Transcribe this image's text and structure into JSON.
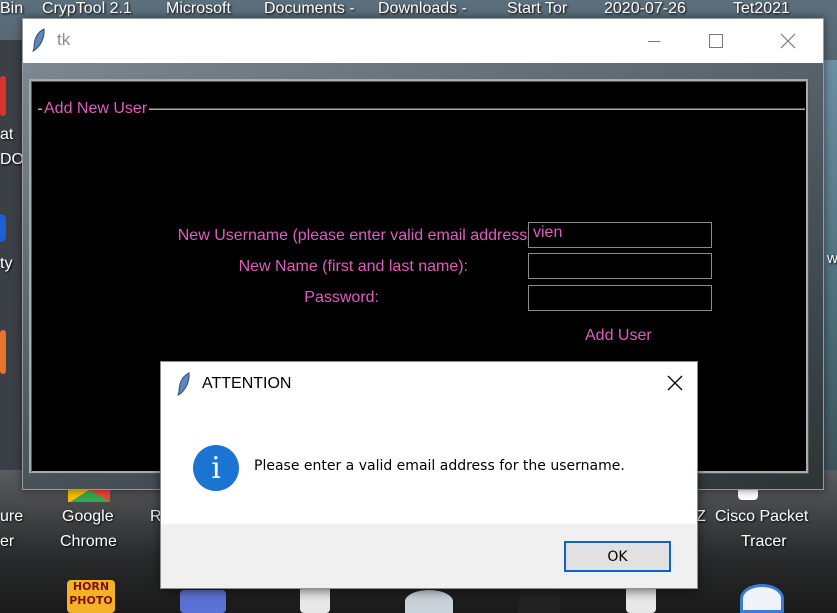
{
  "desktop": {
    "top_labels": [
      "Bin",
      "CrypTool 2.1",
      "Microsoft",
      "Documents -",
      "Downloads -",
      "Start Tor",
      "2020-07-26",
      "Tet2021"
    ],
    "left_labels": [
      "at",
      "DO",
      "ty",
      "ure",
      "er"
    ],
    "bottom_labels": [
      "Google",
      "Chrome",
      "Cisco Packet",
      "Tracer",
      "R",
      "Z",
      "w"
    ],
    "horn_icon_text": "HORN PHOTO"
  },
  "tk_window": {
    "title": "tk",
    "labelframe": "Add New User",
    "username_label": "New Username (please enter valid email address):",
    "name_label": "New Name (first and last name):",
    "password_label": "Password:",
    "username_value": "vien",
    "name_value": "",
    "password_value": "",
    "add_button": "Add User"
  },
  "dialog": {
    "title": "ATTENTION",
    "message": "Please enter a valid email address for the username.",
    "ok_button": "OK",
    "icon_glyph": "i"
  },
  "colors": {
    "accent_pink": "#e05cc0",
    "info_blue": "#1b74d2"
  }
}
